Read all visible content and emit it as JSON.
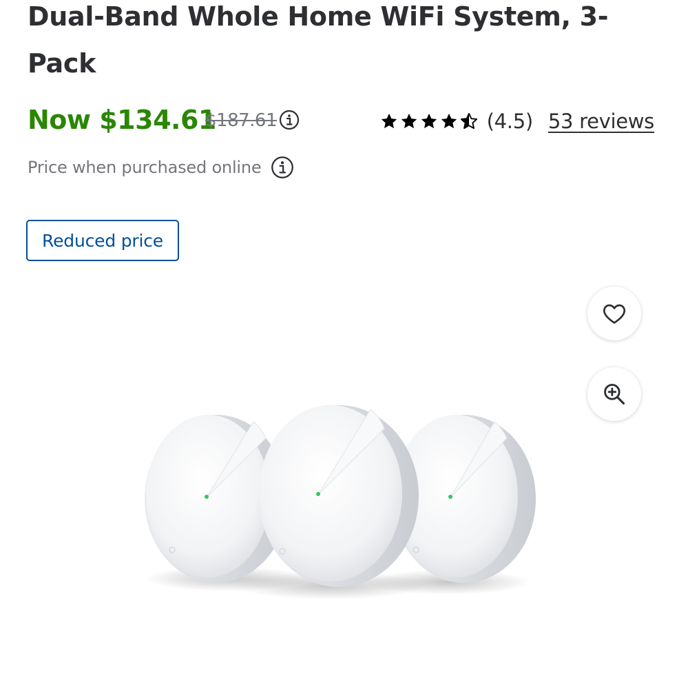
{
  "product": {
    "title": "Dual-Band Whole Home WiFi System, 3-Pack"
  },
  "pricing": {
    "now_price": "Now $134.61",
    "was_price": "$187.61",
    "note": "Price when purchased online",
    "badge": "Reduced price"
  },
  "rating": {
    "stars": 4.5,
    "value_label": "(4.5)",
    "reviews_link": "53 reviews"
  },
  "actions": {
    "favorite_icon": "heart-icon",
    "zoom_icon": "zoom-in-icon"
  },
  "image": {
    "alt": "three white mesh WiFi units",
    "units": 3
  },
  "colors": {
    "price_green": "#2a8703",
    "badge_blue": "#004f9a",
    "muted_gray": "#74767c",
    "text_dark": "#2e2f32"
  }
}
